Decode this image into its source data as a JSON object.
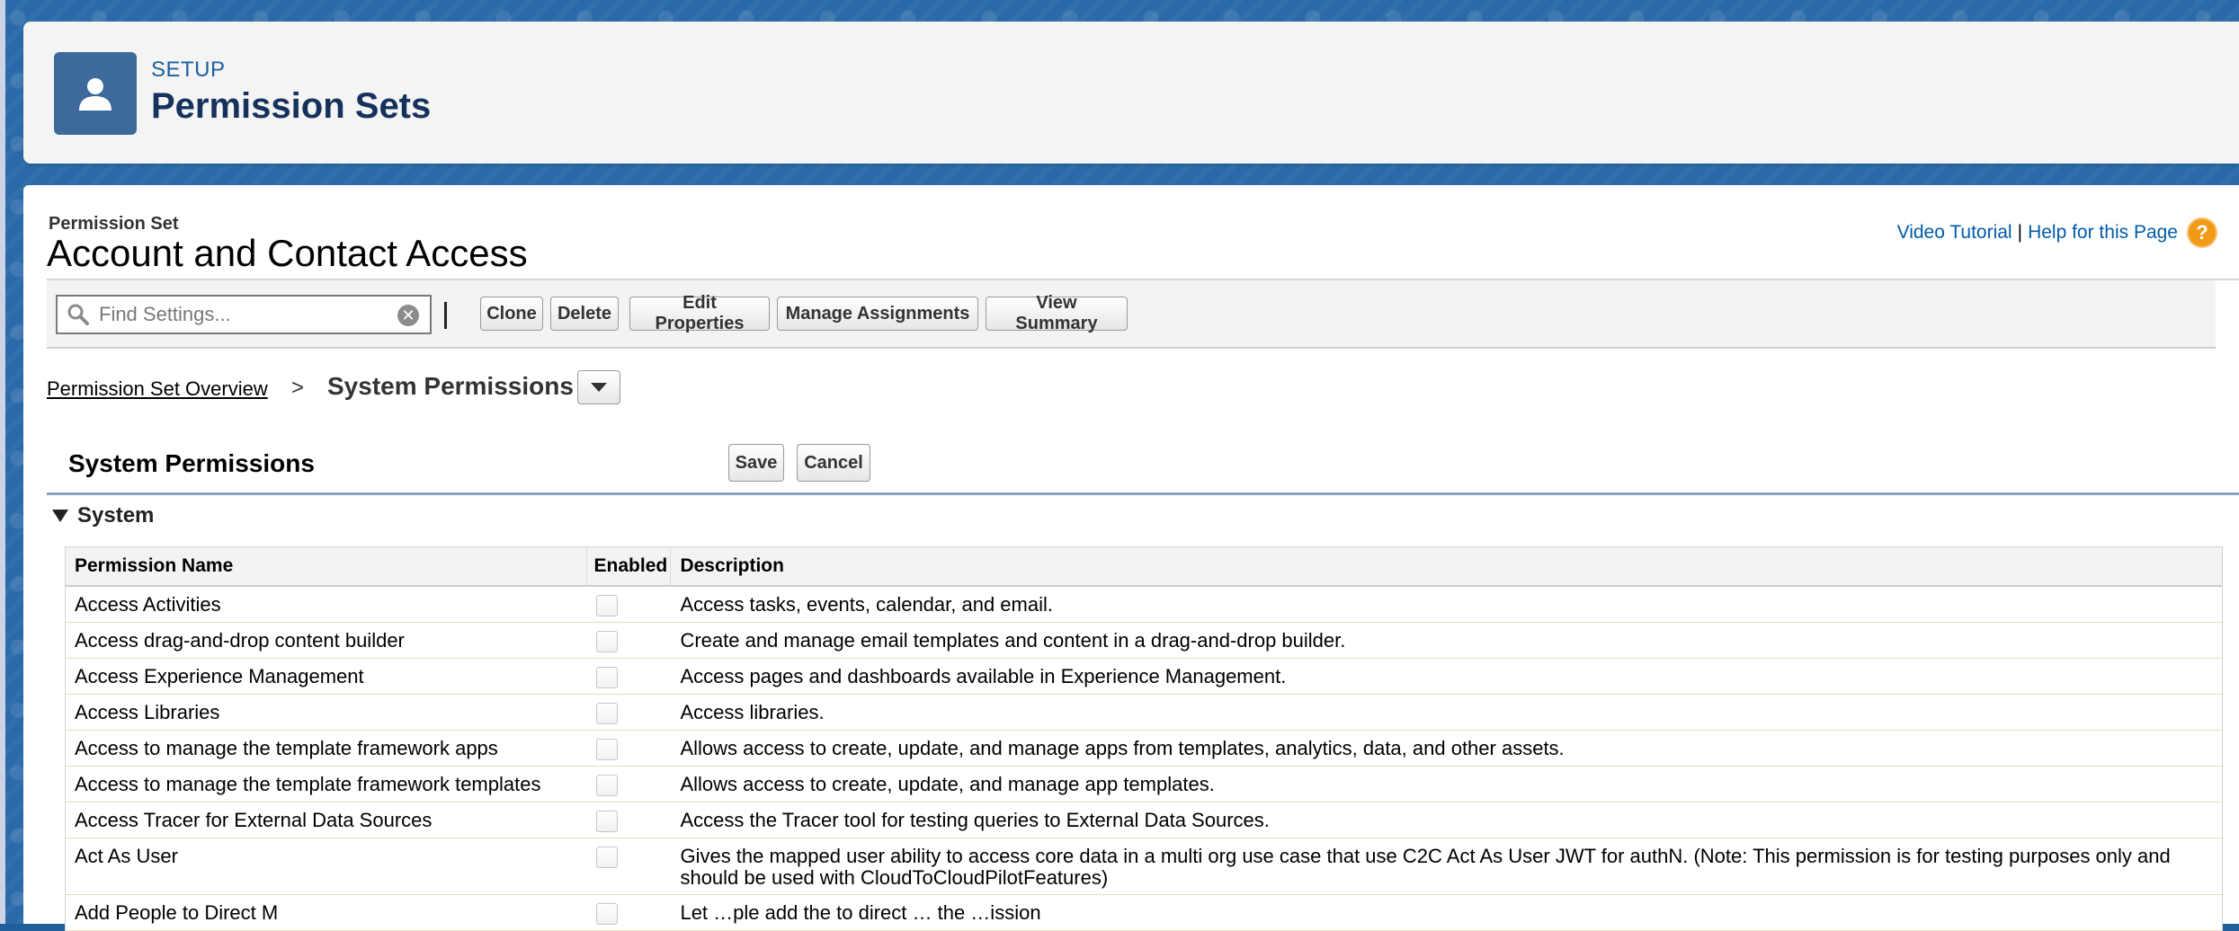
{
  "setup": {
    "eyebrow": "SETUP",
    "title": "Permission Sets"
  },
  "page": {
    "label": "Permission Set",
    "title": "Account and Contact Access",
    "video_tutorial": "Video Tutorial",
    "link_separator": "|",
    "help_link": "Help for this Page",
    "help_icon_glyph": "?"
  },
  "toolbar": {
    "search_placeholder": "Find Settings...",
    "clear_glyph": "✕",
    "buttons": [
      "Clone",
      "Delete",
      "Edit Properties",
      "Manage Assignments",
      "View Summary"
    ]
  },
  "breadcrumb": {
    "overview": "Permission Set Overview",
    "separator": ">",
    "current": "System Permissions"
  },
  "section": {
    "title": "System Permissions",
    "save": "Save",
    "cancel": "Cancel",
    "group": "System"
  },
  "table": {
    "headers": [
      "Permission Name",
      "Enabled",
      "Description"
    ],
    "rows": [
      {
        "name": "Access Activities",
        "enabled": false,
        "description": "Access tasks, events, calendar, and email."
      },
      {
        "name": "Access drag-and-drop content builder",
        "enabled": false,
        "description": "Create and manage email templates and content in a drag-and-drop builder."
      },
      {
        "name": "Access Experience Management",
        "enabled": false,
        "description": "Access pages and dashboards available in Experience Management."
      },
      {
        "name": "Access Libraries",
        "enabled": false,
        "description": "Access libraries."
      },
      {
        "name": "Access to manage the template framework apps",
        "enabled": false,
        "description": "Allows access to create, update, and manage apps from templates, analytics, data, and other assets."
      },
      {
        "name": "Access to manage the template framework templates",
        "enabled": false,
        "description": "Allows access to create, update, and manage app templates."
      },
      {
        "name": "Access Tracer for External Data Sources",
        "enabled": false,
        "description": "Access the Tracer tool for testing queries to External Data Sources."
      },
      {
        "name": "Act As User",
        "enabled": false,
        "description": "Gives the mapped user ability to access core data in a multi org use case that use C2C Act As User JWT for authN. (Note: This permission is for testing purposes only and should be used with CloudToCloudPilotFeatures)"
      },
      {
        "name": "Add People to Direct M",
        "enabled": false,
        "description": "Let …ple add the to direct … the …ission"
      }
    ]
  },
  "colors": {
    "setup_icon": "#3d6a9b",
    "link": "#015ba7",
    "help_icon": "#f19a17",
    "section_rule": "#8aa3bd"
  },
  "icons": {
    "setup": "user-icon",
    "search": "magnifier-icon",
    "clear": "clear-circle-icon",
    "dropdown": "chevron-down-icon",
    "help": "question-circle-icon",
    "group_toggle": "triangle-down-icon"
  }
}
